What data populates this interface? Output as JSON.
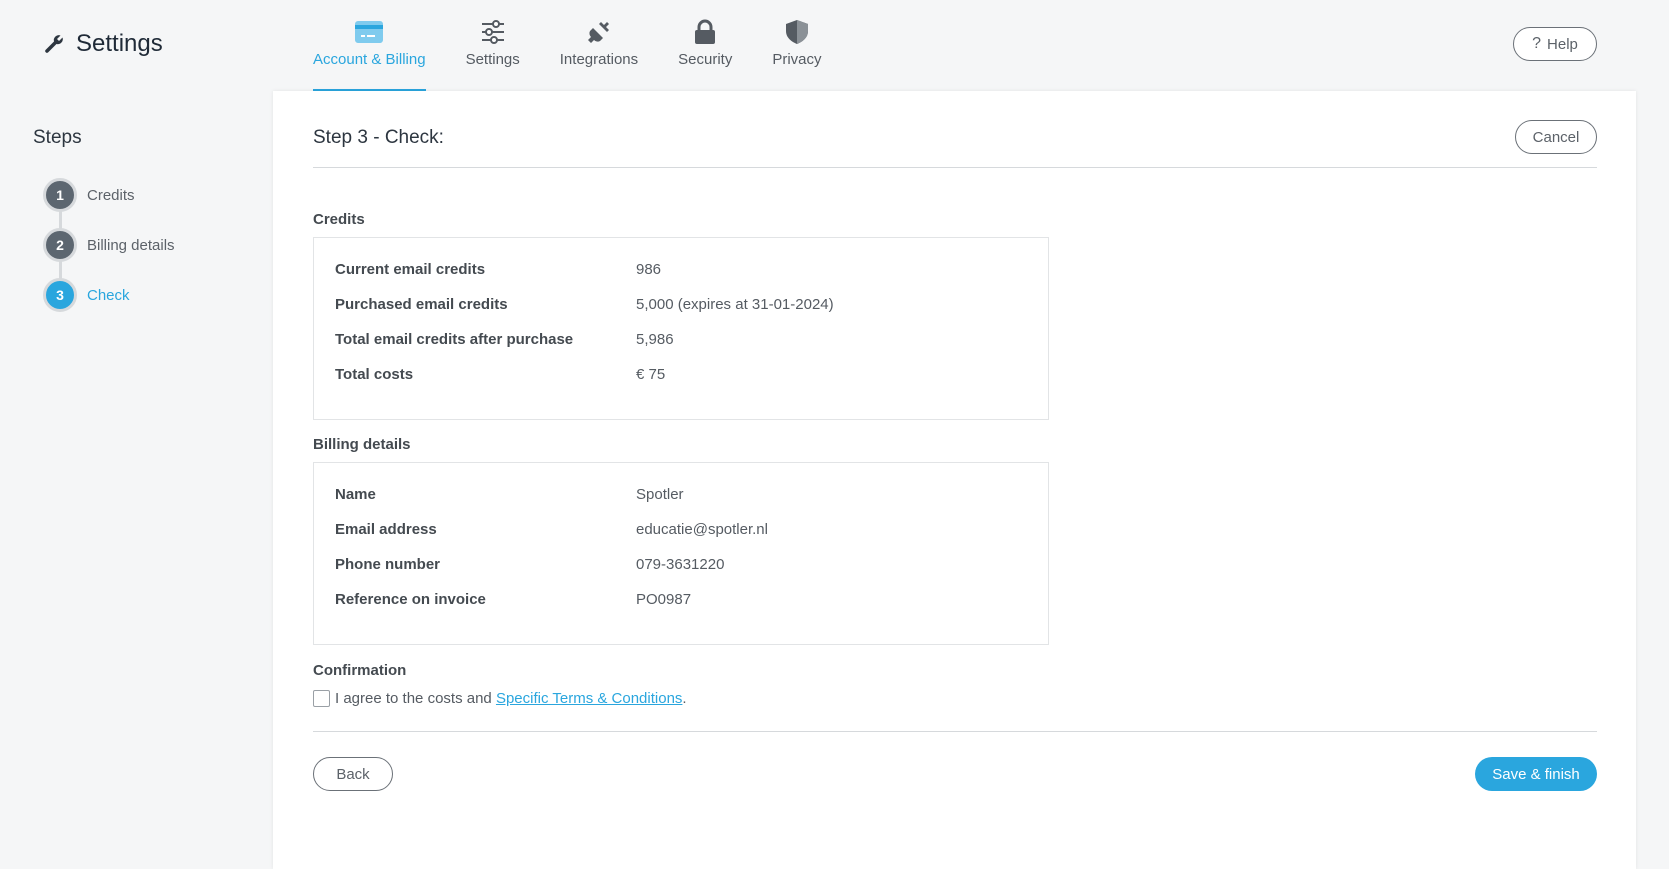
{
  "app": {
    "title": "Settings",
    "icon": "wrench-icon"
  },
  "nav": {
    "tabs": [
      {
        "label": "Account & Billing",
        "icon": "credit-card-icon",
        "active": true
      },
      {
        "label": "Settings",
        "icon": "sliders-icon",
        "active": false
      },
      {
        "label": "Integrations",
        "icon": "plug-icon",
        "active": false
      },
      {
        "label": "Security",
        "icon": "lock-icon",
        "active": false
      },
      {
        "label": "Privacy",
        "icon": "shield-icon",
        "active": false
      }
    ],
    "help_label": "Help"
  },
  "sidebar": {
    "title": "Steps",
    "steps": [
      {
        "number": "1",
        "label": "Credits"
      },
      {
        "number": "2",
        "label": "Billing details"
      },
      {
        "number": "3",
        "label": "Check"
      }
    ]
  },
  "main": {
    "title": "Step 3 - Check:",
    "cancel_label": "Cancel",
    "credits": {
      "title": "Credits",
      "rows": [
        {
          "label": "Current email credits",
          "value": "986"
        },
        {
          "label": "Purchased email credits",
          "value": "5,000 (expires at 31-01-2024)"
        },
        {
          "label": "Total email credits after purchase",
          "value": "5,986"
        },
        {
          "label": "Total costs",
          "value": "€ 75"
        }
      ]
    },
    "billing": {
      "title": "Billing details",
      "rows": [
        {
          "label": "Name",
          "value": "Spotler"
        },
        {
          "label": "Email address",
          "value": "educatie@spotler.nl"
        },
        {
          "label": "Phone number",
          "value": "079-3631220"
        },
        {
          "label": "Reference on invoice",
          "value": "PO0987"
        }
      ]
    },
    "confirmation": {
      "title": "Confirmation",
      "text_before": "I agree to the costs and",
      "link_text": "Specific Terms & Conditions",
      "text_after": "."
    },
    "back_label": "Back",
    "save_label": "Save & finish"
  },
  "colors": {
    "accent": "#2aa6de",
    "step_inactive": "#5c6670"
  }
}
